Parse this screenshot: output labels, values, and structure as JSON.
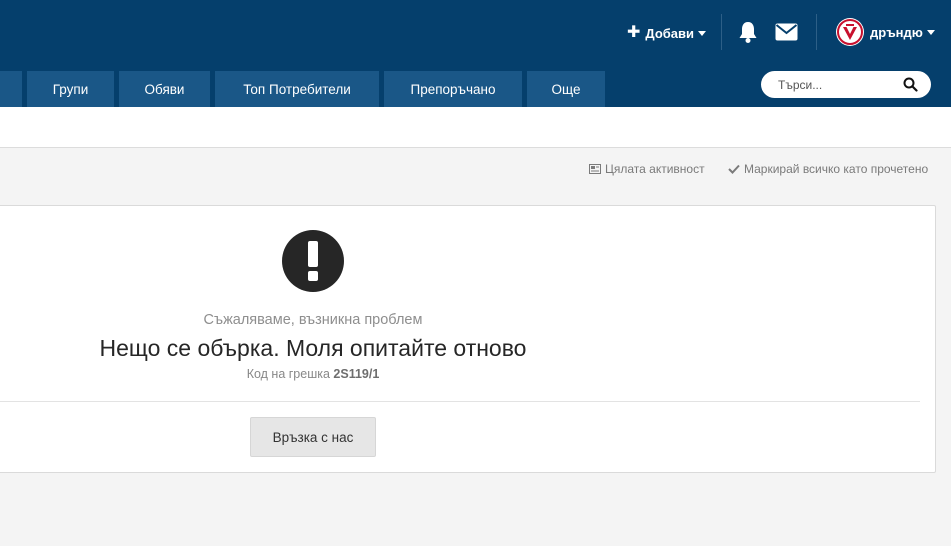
{
  "header": {
    "add_label": "Добави",
    "username": "дръндю",
    "icons": {
      "add": "plus-icon",
      "notifications": "bell-icon",
      "messages": "envelope-icon",
      "user_menu": "caret-down-icon"
    }
  },
  "nav": {
    "items": [
      {
        "label": ""
      },
      {
        "label": "Групи"
      },
      {
        "label": "Обяви"
      },
      {
        "label": "Топ Потребители"
      },
      {
        "label": "Препоръчано"
      },
      {
        "label": "Още"
      }
    ]
  },
  "search": {
    "placeholder": "Търси...",
    "icon": "search-icon"
  },
  "actions": {
    "all_activity": "Цялата активност",
    "mark_all_read": "Маркирай всичко като прочетено"
  },
  "error": {
    "subtitle": "Съжаляваме, възникна проблем",
    "title": "Нещо се обърка. Моля опитайте отново",
    "code_label": "Код на грешка",
    "code": "2S119/1",
    "contact_button": "Връзка с нас",
    "icon": "exclamation-circle-icon"
  },
  "colors": {
    "header_bg": "#053f6c",
    "nav_item_bg": "#1a5787",
    "page_bg": "#f4f4f4",
    "error_icon_bg": "#262626"
  }
}
